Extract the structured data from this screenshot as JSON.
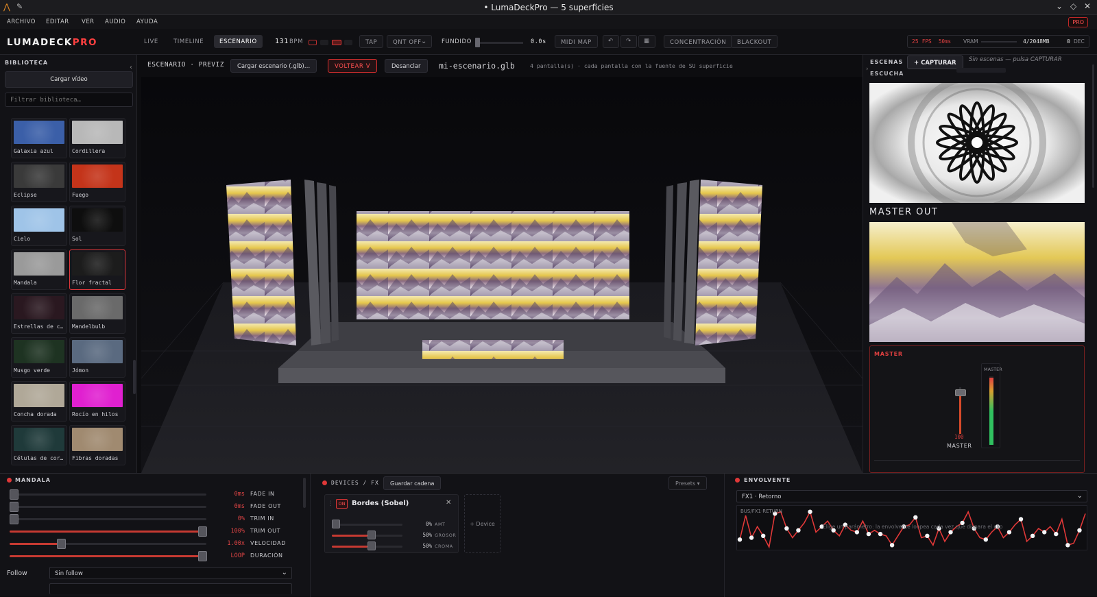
{
  "window": {
    "title": "• LumaDeckPro — 5 superficies"
  },
  "menu": [
    "ARCHIVO",
    "EDITAR",
    "VER",
    "AUDIO",
    "AYUDA"
  ],
  "pro_badge": "PRO",
  "brand": {
    "main": "LUMADECK",
    "accent": "PRO"
  },
  "toolbar": {
    "tabs": [
      "LIVE",
      "TIMELINE",
      "ESCENARIO"
    ],
    "active_tab": "ESCENARIO",
    "bpm": "131",
    "bpm_label": "BPM",
    "tap": "TAP",
    "quant": "QNT OFF",
    "fundido": "FUNDIDO",
    "fundido_value": "0.0s",
    "fundido_level": 0,
    "midi": "MIDI MAP",
    "concentracion": "CONCENTRACIÓN",
    "blackout": "BLACKOUT",
    "fps": "25",
    "fps_label": "FPS",
    "ms": "50ms",
    "vram_label": "VRAM",
    "vram": "4/2048MB",
    "dec": "0",
    "dec_label": "DEC"
  },
  "library": {
    "title": "BIBLIOTECA",
    "load": "Cargar vídeo",
    "filter_placeholder": "Filtrar biblioteca…",
    "items": [
      {
        "label": "Galaxia azul",
        "color": "#3b5fa8"
      },
      {
        "label": "Cordillera",
        "color": "#b8b8b8"
      },
      {
        "label": "Eclipse",
        "color": "#3a3a3a"
      },
      {
        "label": "Fuego",
        "color": "#c4341a"
      },
      {
        "label": "Cielo",
        "color": "#9fc4e8"
      },
      {
        "label": "Sol",
        "color": "#0e0e0e"
      },
      {
        "label": "Mandala",
        "color": "#9a9a9a"
      },
      {
        "label": "Flor fractal",
        "color": "#1c1c1c"
      },
      {
        "label": "Estrellas de c…",
        "color": "#2a1820"
      },
      {
        "label": "Mandelbulb",
        "color": "#6a6a6a"
      },
      {
        "label": "Musgo verde",
        "color": "#1e3322"
      },
      {
        "label": "Jómon",
        "color": "#5a6a80"
      },
      {
        "label": "Concha dorada",
        "color": "#b0a898"
      },
      {
        "label": "Rocío en hilos",
        "color": "#e020d0"
      },
      {
        "label": "Células de cor…",
        "color": "#1f3a3a"
      },
      {
        "label": "Fibras doradas",
        "color": "#a08a70"
      }
    ],
    "selected": "Flor fractal"
  },
  "stage": {
    "head": "ESCENARIO · PREVIZ",
    "load_scene": "Cargar escenario (.glb)…",
    "flip": "VOLTEAR V",
    "unpin": "Desanclar",
    "file": "mi-escenario.glb",
    "info": "4 pantalla(s) · cada pantalla con la fuente de SU superficie"
  },
  "right": {
    "scenes_label": "ESCENAS",
    "capture": "+ CAPTURAR",
    "listen": "ESCUCHA",
    "empty": "Sin escenas — pulsa CAPTURAR",
    "master_out": "MASTER OUT",
    "master_title": "MASTER",
    "meter_label": "MASTER",
    "fader_value": "100",
    "fader_label": "MASTER",
    "fader_level": 0.88,
    "meter_level": 0.98
  },
  "clip": {
    "title": "MANDALA",
    "rows": [
      {
        "value": "0ms",
        "label": "FADE IN",
        "level": 0.02
      },
      {
        "value": "0ms",
        "label": "FADE OUT",
        "level": 0.02
      },
      {
        "value": "0%",
        "label": "TRIM IN",
        "level": 0.02
      },
      {
        "value": "100%",
        "label": "TRIM OUT",
        "level": 0.98
      },
      {
        "value": "1.00x",
        "label": "VELOCIDAD",
        "level": 0.26
      },
      {
        "value": "LOOP",
        "label": "DURACIÓN",
        "level": 0.98
      }
    ],
    "follow_label": "Follow",
    "follow_value": "Sin follow"
  },
  "devices": {
    "title": "DEVICES / FX",
    "save": "Guardar cadena",
    "presets": "Presets ▾",
    "device_on": "ON",
    "device_name": "Bordes (Sobel)",
    "add": "+ Device",
    "params": [
      {
        "value": "0%",
        "label": "AMT",
        "level": 0
      },
      {
        "value": "50%",
        "label": "GROSOR",
        "level": 0.5
      },
      {
        "value": "50%",
        "label": "CROMA",
        "level": 0.5
      }
    ]
  },
  "envelope": {
    "title": "ENVOLVENTE",
    "target": "FX1 · Retorno",
    "bus": "BUS/FX1·RETURN",
    "hint": "Elige un parámetro: la envolvente loopea cada vez que dispara el clip",
    "points": [
      0.2,
      0.85,
      0.25,
      0.55,
      0.3,
      0.0,
      0.9,
      0.95,
      0.5,
      0.25,
      0.45,
      0.65,
      0.95,
      0.4,
      0.55,
      0.7,
      0.45,
      0.3,
      0.6,
      0.45,
      0.4,
      0.7,
      0.35,
      0.45,
      0.35,
      0.3,
      0.05,
      0.3,
      0.55,
      0.6,
      0.8,
      0.25,
      0.3,
      0.05,
      0.5,
      0.15,
      0.4,
      0.55,
      0.65,
      0.95,
      0.5,
      0.25,
      0.2,
      0.4,
      0.55,
      0.25,
      0.4,
      0.6,
      0.75,
      0.15,
      0.3,
      0.5,
      0.4,
      0.55,
      0.35,
      0.75,
      0.05,
      0.1,
      0.45,
      0.9
    ]
  }
}
